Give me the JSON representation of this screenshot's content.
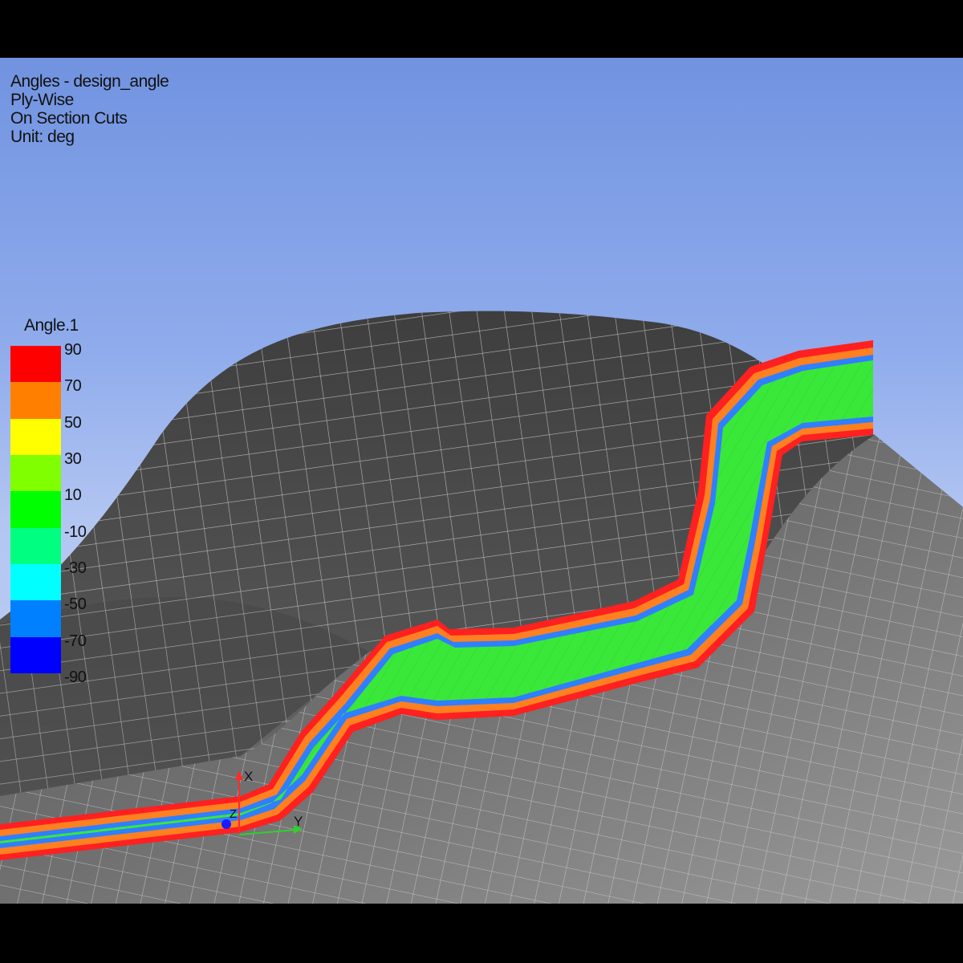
{
  "info": {
    "line1": "Angles - design_angle",
    "line2": "Ply-Wise",
    "line3": "On Section Cuts",
    "line4": "Unit: deg"
  },
  "legend": {
    "title": "Angle.1",
    "labels": [
      "90",
      "70",
      "50",
      "30",
      "10",
      "-10",
      "-30",
      "-50",
      "-70",
      "-90"
    ],
    "colors": [
      "#ff0000",
      "#ff8000",
      "#ffff00",
      "#80ff00",
      "#00ff00",
      "#00ff80",
      "#00ffff",
      "#0080ff",
      "#0000ff"
    ]
  },
  "triad": {
    "x_label": "X",
    "y_label": "Y",
    "z_label": "Z"
  },
  "colors": {
    "mesh_surface": "#4e4e4e",
    "mesh_lines": "#c8c8c8",
    "section_outer": "#ff2020",
    "section_mid": "#ff8020",
    "section_inner": "#2f7fff",
    "section_core": "#3ae83a"
  }
}
